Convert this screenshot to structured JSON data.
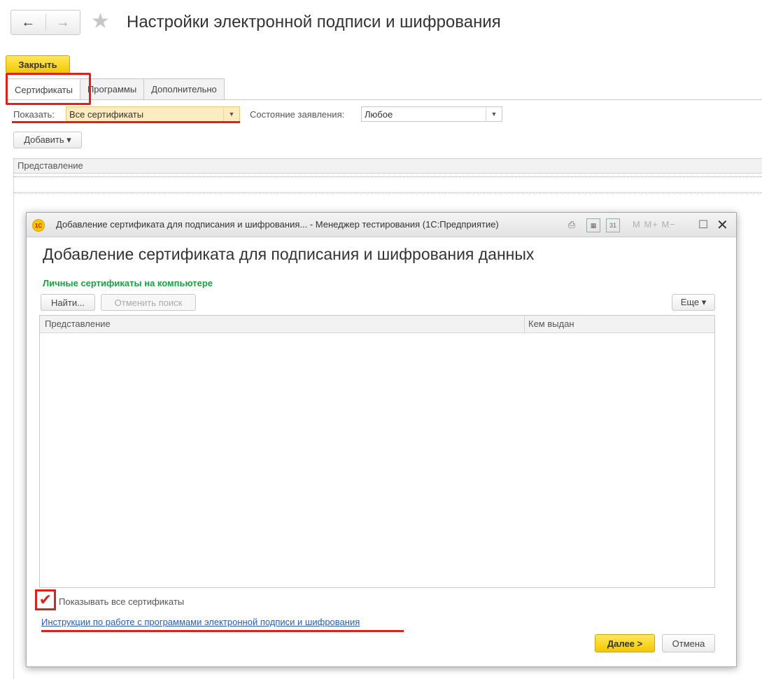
{
  "nav": {
    "back": "←",
    "forward": "→",
    "star": "★"
  },
  "page_title": "Настройки электронной подписи и шифрования",
  "toolbar": {
    "close_label": "Закрыть"
  },
  "tabs": [
    {
      "label": "Сертификаты",
      "active": true
    },
    {
      "label": "Программы",
      "active": false
    },
    {
      "label": "Дополнительно",
      "active": false
    }
  ],
  "filters": {
    "show_label": "Показать:",
    "show_value": "Все сертификаты",
    "state_label": "Состояние заявления:",
    "state_value": "Любое"
  },
  "add_button": "Добавить ▾",
  "list": {
    "column": "Представление"
  },
  "dialog": {
    "title": "Добавление сертификата для подписания и шифрования... - Менеджер тестирования (1С:Предприятие)",
    "logo": "1С",
    "toolbar_m": "M  M+  M−",
    "heading": "Добавление сертификата для подписания и шифрования данных",
    "section": "Личные сертификаты на компьютере",
    "find_button": "Найти...",
    "cancel_search_button": "Отменить поиск",
    "more_button": "Еще ▾",
    "columns": [
      "Представление",
      "Кем выдан"
    ],
    "show_all_label": "Показывать все сертификаты",
    "show_all_checked": true,
    "instructions_link": "Инструкции по работе с программами электронной подписи и шифрования",
    "next_button": "Далее >",
    "cancel_button": "Отмена"
  },
  "colors": {
    "accent_yellow": "#f3c800",
    "highlight_red": "#d9231d",
    "section_green": "#19a040",
    "link_blue": "#2a5db0"
  }
}
